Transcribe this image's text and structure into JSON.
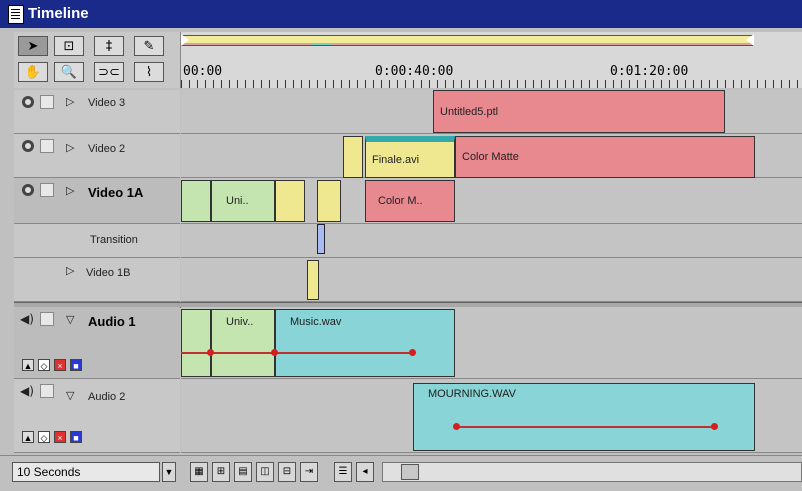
{
  "window": {
    "title": "Timeline"
  },
  "tools": {
    "row1": [
      "selection-arrow",
      "range-select",
      "track-select",
      "razor"
    ],
    "row2": [
      "hand",
      "zoom",
      "link",
      "edge"
    ],
    "glyphs": [
      "➤",
      "⊡",
      "‡",
      "✎",
      "✋",
      "🔍",
      "⊃⊂",
      "⌇"
    ]
  },
  "ruler": {
    "timecodes": [
      "00:00",
      "0:00:40:00",
      "0:01:20:00"
    ]
  },
  "tracks": {
    "video3": {
      "label": "Video 3",
      "clips": {
        "c1": "Untitled5.ptl"
      }
    },
    "video2": {
      "label": "Video 2",
      "clips": {
        "c1": "Finale.avi",
        "c2": "Color Matte"
      }
    },
    "video1a": {
      "label": "Video 1A",
      "clips": {
        "c1": "Uni..",
        "c2": "Color M.."
      }
    },
    "transition": {
      "label": "Transition"
    },
    "video1b": {
      "label": "Video 1B"
    },
    "audio1": {
      "label": "Audio 1",
      "clips": {
        "c1": "Univ..",
        "c2": "Music.wav"
      }
    },
    "audio2": {
      "label": "Audio 2",
      "clips": {
        "c1": "MOURNING.WAV"
      }
    }
  },
  "bottom": {
    "zoom": "10 Seconds"
  },
  "colors": {
    "pink": "#e8888f",
    "yellow": "#f0e890",
    "green": "#c4e4b0",
    "teal": "#88d4d6",
    "titlebar": "#1a2a8a"
  }
}
